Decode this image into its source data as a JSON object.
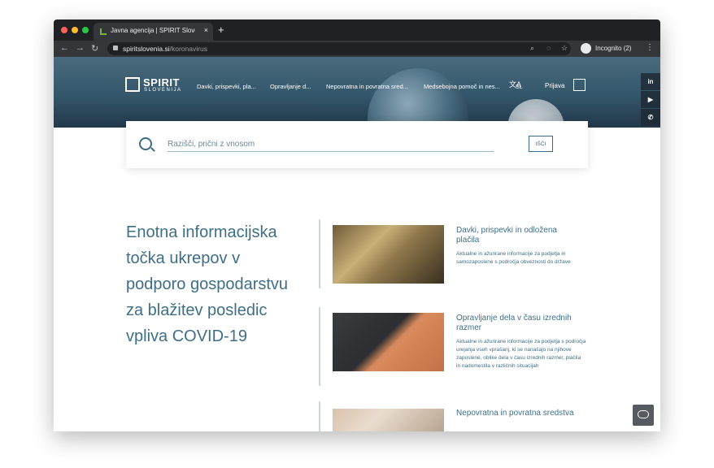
{
  "browser": {
    "tab_title": "Javna agencija | SPIRIT Sloven",
    "tab_close": "×",
    "new_tab": "+",
    "url_domain": "spiritslovenia.si",
    "url_path": "/koronavirus",
    "incognito_label": "Incognito (2)",
    "back": "←",
    "forward": "→",
    "reload": "↻",
    "menu": "⋮"
  },
  "header": {
    "logo_main": "SPIRIT",
    "logo_sub": "SLOVENIJA",
    "nav": [
      {
        "label": "Davki, prispevki, pla..."
      },
      {
        "label": "Opravljanje d..."
      },
      {
        "label": "Nepovratna in povratna sred..."
      },
      {
        "label": "Medsebojna pomoč in nes..."
      }
    ],
    "lang_code": "SL",
    "login": "Prijava"
  },
  "social": {
    "linkedin": "in",
    "youtube": "▶",
    "phone": "✆"
  },
  "search": {
    "placeholder": "Razišči, prični z vnosom",
    "button": "IŠČI"
  },
  "lead": "Enotna informacijska točka ukrepov v podporo gospodarstvu za blažitev posledic vpliva COVID-19",
  "cards": [
    {
      "title": "Davki, prispevki in odložena plačila",
      "description": "Aktualne in ažurirane informacije za podjetja in samozaposlene s področja obveznosti do države"
    },
    {
      "title": "Opravljanje dela v času izrednih razmer",
      "description": "Aktualne in ažurirane informacije za podjetja s področja urejanja vseh vprašanj, ki se nanašajo na njihove zaposlene, oblike dela v času izrednih razmer, plačila in nadomestila v različnih situacijah"
    },
    {
      "title": "Nepovratna in povratna sredstva",
      "description": ""
    }
  ],
  "colors": {
    "brand": "#3f6e87",
    "browser_dark": "#202124",
    "browser_tab": "#35363a"
  }
}
